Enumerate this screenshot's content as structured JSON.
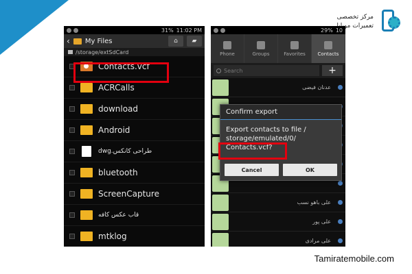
{
  "brand": {
    "line1": "مرکز تخصصی",
    "line2": "تعمیرات موبایل",
    "accent": "#1a7fb5"
  },
  "footer": {
    "site": "Tamiratemobile.com"
  },
  "left_screen": {
    "status": {
      "battery": "31%",
      "time": "11:02 PM"
    },
    "appbar": {
      "back_icon": "back-arrow-icon",
      "title": "My Files",
      "home_icon": "home-icon",
      "folder_icon": "folder-up-icon"
    },
    "path": "/storage/extSdCard",
    "files": [
      {
        "name": "Contacts.vcf",
        "type": "vcf"
      },
      {
        "name": "ACRCalls",
        "type": "folder"
      },
      {
        "name": "download",
        "type": "folder"
      },
      {
        "name": "Android",
        "type": "folder"
      },
      {
        "name": "طراحی کانکس.dwg",
        "type": "doc"
      },
      {
        "name": "bluetooth",
        "type": "folder"
      },
      {
        "name": "ScreenCapture",
        "type": "folder"
      },
      {
        "name": "قاب عکس کافه",
        "type": "folder"
      },
      {
        "name": "mtklog",
        "type": "folder"
      }
    ],
    "highlight_color": "#e3000f"
  },
  "right_screen": {
    "status": {
      "battery": "29%",
      "time": "10"
    },
    "tabs": [
      "Phone",
      "Groups",
      "Favorites",
      "Contacts"
    ],
    "search_placeholder": "Search",
    "add_label": "+",
    "contacts": [
      "عدنان فیضی",
      "عدنان فیضی",
      "",
      "",
      "",
      "",
      "علی باهو نسب",
      "علی پور",
      "علی مرادی"
    ],
    "dialog": {
      "title": "Confirm export",
      "message_line1": "Export contacts to file /",
      "message_line2": "storage/emulated/0/",
      "message_line3": "Contacts.vcf?",
      "cancel": "Cancel",
      "ok": "OK"
    }
  }
}
